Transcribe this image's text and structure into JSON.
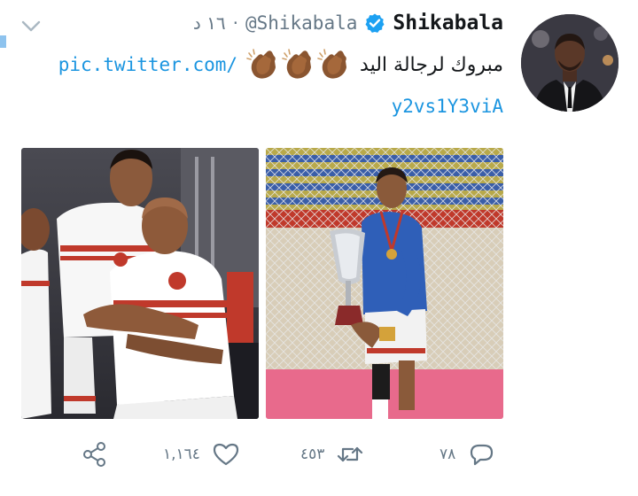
{
  "tweet": {
    "author_name": "Shikabala",
    "author_handle": "@Shikabala",
    "dot": "·",
    "time": "١٦ د",
    "text": "مبروك لرجالة اليد",
    "link_part1": "pic.twitter.com/",
    "link_part2": "y2vs1Y3viA",
    "emoji": "clapping-hands-medium-dark-skin",
    "emoji_count": 3
  },
  "actions": {
    "reply_count": "٧٨",
    "retweet_count": "٤٥٣",
    "like_count": "١,١٦٤"
  },
  "colors": {
    "link": "#1b95e0",
    "muted": "#657786",
    "text": "#14171a",
    "verified": "#1da1f2"
  }
}
